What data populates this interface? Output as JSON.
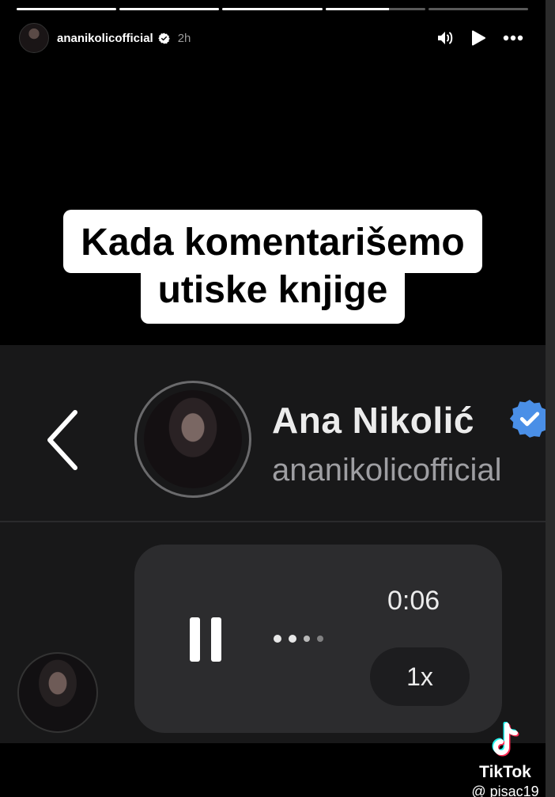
{
  "story": {
    "progress": [
      1.0,
      1.0,
      1.0,
      0.64,
      0.0
    ],
    "username": "ananikolicofficial",
    "time_ago": "2h",
    "icons": [
      "sound-icon",
      "play-icon",
      "more-icon",
      "verified-badge-icon"
    ]
  },
  "caption": {
    "line1": "Kada komentarišemo",
    "line2": "utiske knjige"
  },
  "video": {
    "profile_name": "Ana Nikolić",
    "profile_handle": "ananikolicofficial",
    "voice_message": {
      "duration": "0:06",
      "speed": "1x"
    },
    "icons": [
      "back-chevron-icon",
      "pause-icon",
      "waveform-icon"
    ]
  },
  "watermark": {
    "brand": "TikTok",
    "handle": "@ pisac19"
  },
  "colors": {
    "verified_blue": "#0095f6",
    "background": "#000000",
    "bubble": "#2c2c2e"
  }
}
